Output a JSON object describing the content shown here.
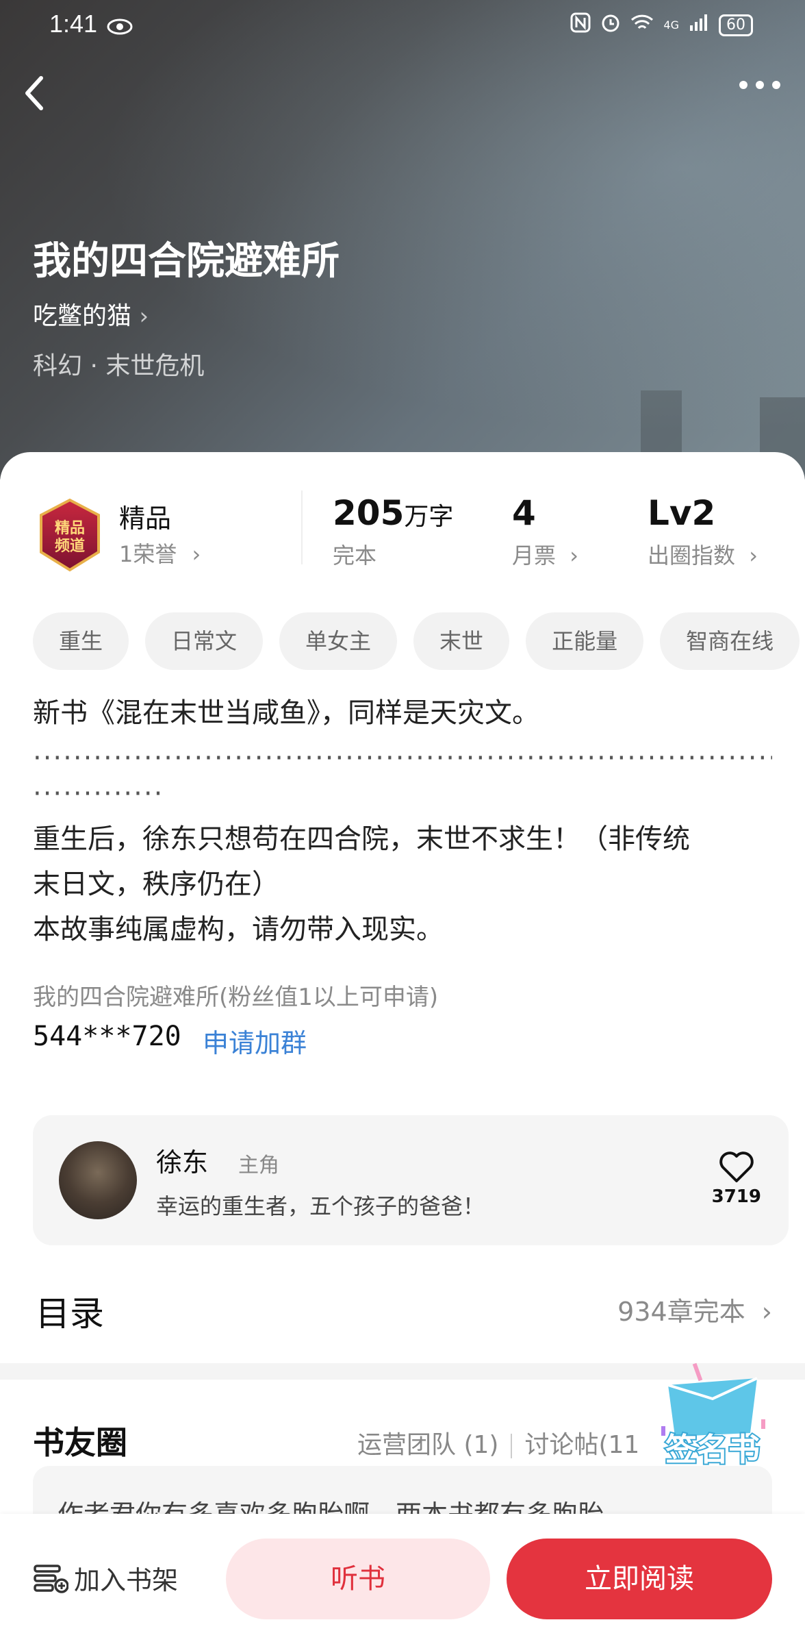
{
  "status_bar": {
    "time": "1:41",
    "network": "4G",
    "battery": "60"
  },
  "book": {
    "title": "我的四合院避难所",
    "author": "吃鳖的猫",
    "genre": "科幻 · 末世危机"
  },
  "stats": {
    "channel_label": "精品",
    "channel_sub": "1荣誉",
    "badge_text": "精品频道",
    "words_value": "205",
    "words_unit": "万字",
    "words_label": "完本",
    "tickets_value": "4",
    "tickets_label": "月票",
    "circle_value": "Lv2",
    "circle_label": "出圈指数"
  },
  "tags": [
    "重生",
    "日常文",
    "单女主",
    "末世",
    "正能量",
    "智商在线"
  ],
  "description": {
    "line1": "新书《混在末世当咸鱼》，同样是天灾文。",
    "dots1": "··········································································",
    "dots2": "·············",
    "line2": "重生后，徐东只想苟在四合院，末世不求生！（非传统",
    "line3": "末日文，秩序仍在）",
    "line4": "本故事纯属虚构，请勿带入现实。"
  },
  "fan_group": {
    "label": "我的四合院避难所(粉丝值1以上可申请)",
    "number": "544***720",
    "link": "申请加群"
  },
  "character": {
    "name": "徐东",
    "role": "主角",
    "desc": "幸运的重生者，五个孩子的爸爸！",
    "likes": "3719"
  },
  "toc": {
    "title": "目录",
    "meta": "934章完本"
  },
  "club": {
    "title": "书友圈",
    "team": "运营团队 (1)",
    "posts": "讨论帖(11",
    "preview": "作者君你有多喜欢多胞胎啊，两本书都有多胞胎",
    "sticker_text": "签名书"
  },
  "bottom": {
    "shelf": "加入书架",
    "listen": "听书",
    "read": "立即阅读"
  },
  "colors": {
    "accent": "#e4343f",
    "link": "#3b82d6"
  }
}
